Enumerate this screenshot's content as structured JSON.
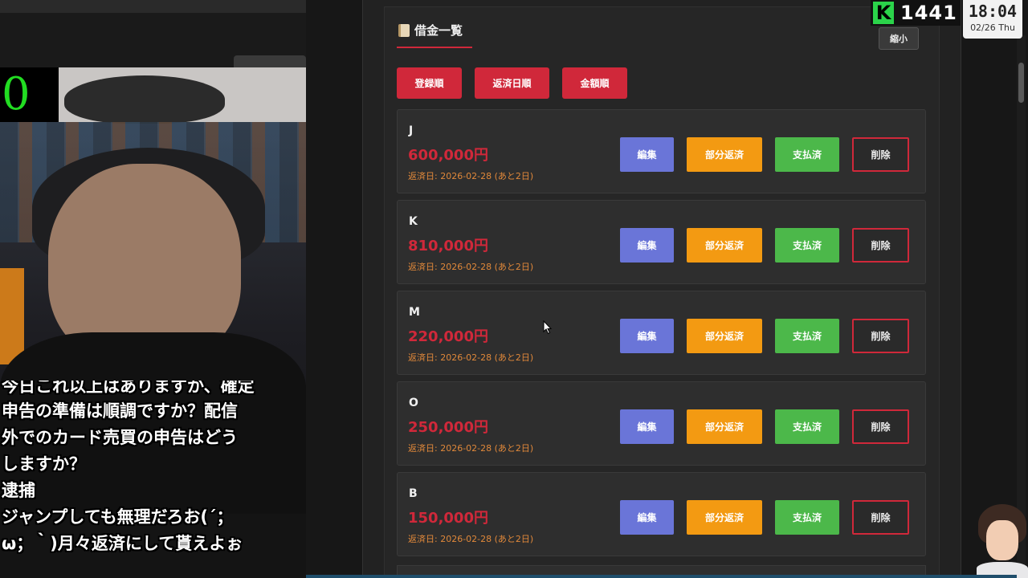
{
  "overlay": {
    "counter": "0",
    "viewer_count": "1441",
    "clock_time": "18:04",
    "clock_date": "02/26 Thu"
  },
  "chat": {
    "cut_line": "今日これ以上はありますか、確定",
    "lines": [
      "申告の準備は順調ですか？配信",
      "外でのカード売買の申告はどう",
      "しますか？",
      "逮捕",
      "ジャンプしても無理だろお(´；",
      "ω；｀)月々返済にして貰えよぉ"
    ]
  },
  "panel": {
    "title": "借金一覧",
    "shrink_label": "縮小",
    "sort_buttons": [
      "登録順",
      "返済日順",
      "金額順"
    ],
    "action_labels": {
      "edit": "編集",
      "partial": "部分返済",
      "paid": "支払済",
      "delete": "削除"
    },
    "debts": [
      {
        "name": "J",
        "amount": "600,000円",
        "due": "返済日: 2026-02-28 (あと2日)"
      },
      {
        "name": "K",
        "amount": "810,000円",
        "due": "返済日: 2026-02-28 (あと2日)"
      },
      {
        "name": "M",
        "amount": "220,000円",
        "due": "返済日: 2026-02-28 (あと2日)"
      },
      {
        "name": "O",
        "amount": "250,000円",
        "due": "返済日: 2026-02-28 (あと2日)"
      },
      {
        "name": "B",
        "amount": "150,000円",
        "due": "返済日: 2026-02-28 (あと2日)"
      }
    ]
  },
  "colors": {
    "accent_red": "#d0283a",
    "edit_blue": "#6a75d8",
    "partial_orange": "#f39a12",
    "paid_green": "#4cb84a",
    "kick_green": "#2bd34a"
  },
  "icons": [
    "scroll-icon",
    "kick-logo-icon",
    "mouse-cursor-icon"
  ]
}
